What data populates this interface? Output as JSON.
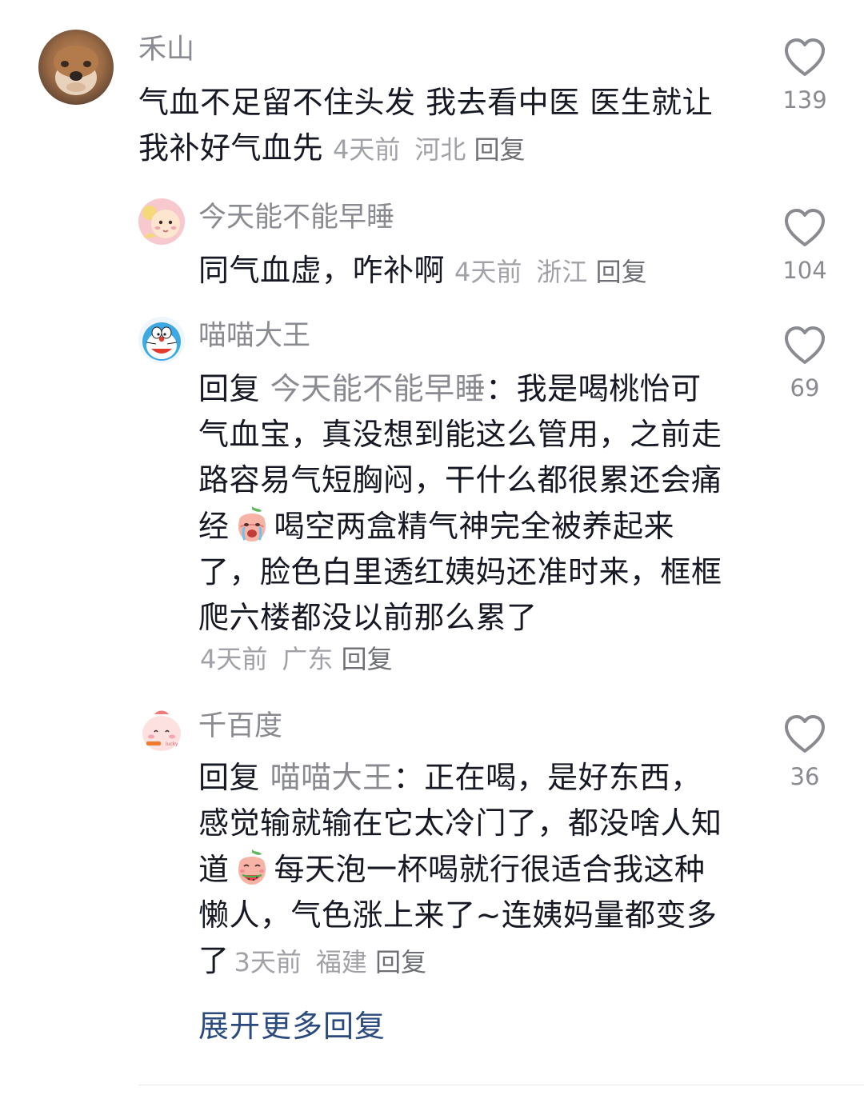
{
  "comments": [
    {
      "username": "禾山",
      "text": "气血不足留不住头发 我去看中医 医生就让我补好气血先",
      "time": "4天前",
      "location": "河北",
      "reply_label": "回复",
      "likes": "139",
      "avatar_icon": "shiba-dog-avatar"
    },
    {
      "username": "今天能不能早睡",
      "text": "同气血虚，咋补啊",
      "time": "4天前",
      "location": "浙江",
      "reply_label": "回复",
      "likes": "104",
      "avatar_icon": "cartoon-girl-avatar"
    },
    {
      "username": "喵喵大王",
      "reply_prefix": "回复",
      "reply_target": "今天能不能早睡",
      "separator": "：",
      "text_before_emoji": "我是喝桃怡可气血宝，真没想到能这么管用，之前走路容易气短胸闷，干什么都很累还会痛经",
      "text_after_emoji": "喝空两盒精气神完全被养起来了，脸色白里透红姨妈还准时来，框框爬六楼都没以前那么累了",
      "emoji_icon": "crying-peach-emoji",
      "time": "4天前",
      "location": "广东",
      "reply_label": "回复",
      "likes": "69",
      "avatar_icon": "doraemon-avatar"
    },
    {
      "username": "千百度",
      "reply_prefix": "回复",
      "reply_target": "喵喵大王",
      "separator": "：",
      "text_before_emoji": "正在喝，是好东西，感觉输就输在它太冷门了，都没啥人知道",
      "text_after_emoji": "每天泡一杯喝就行很适合我这种懒人，气色涨上来了~连姨妈量都变多了",
      "emoji_icon": "eating-watermelon-peach-emoji",
      "time": "3天前",
      "location": "福建",
      "reply_label": "回复",
      "likes": "36",
      "avatar_icon": "pink-peach-avatar"
    }
  ],
  "expand_label": "展开更多回复",
  "colors": {
    "username": "#8a8b91",
    "body_text": "#161823",
    "meta": "#a1a2a7",
    "expand_link": "#2b4a7e"
  }
}
